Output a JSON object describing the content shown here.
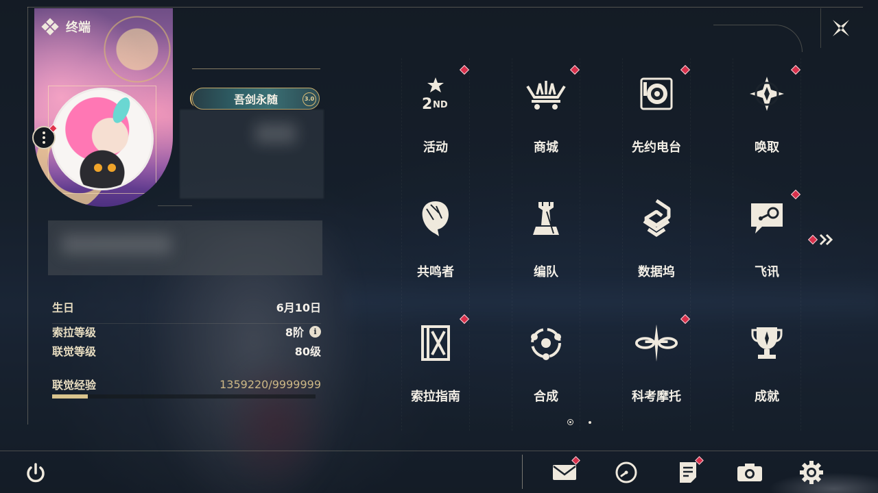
{
  "header": {
    "title": "终端",
    "logo_icon": "diamond-cluster-icon",
    "close_icon": "close-x-icon"
  },
  "profile": {
    "name_badge": "吾剑永随",
    "name_badge_tag": "3.0",
    "menu_icon": "more-vertical-icon",
    "avatar_icon": "avatar-portrait"
  },
  "stats": [
    {
      "label": "生日",
      "value": "6月10日"
    },
    {
      "label": "索拉等级",
      "value": "8阶",
      "info": "i"
    },
    {
      "label": "联觉等级",
      "value": "80级"
    }
  ],
  "experience": {
    "label": "联觉经验",
    "value": "1359220/9999999",
    "progress": 0.1359
  },
  "apps": [
    {
      "label": "活动",
      "icon": "events-icon",
      "badge": true
    },
    {
      "label": "商城",
      "icon": "shop-cart-icon",
      "badge": true
    },
    {
      "label": "先约电台",
      "icon": "radio-record-icon",
      "badge": true
    },
    {
      "label": "唤取",
      "icon": "compass-star-icon",
      "badge": true
    },
    {
      "label": "共鸣者",
      "icon": "character-head-icon",
      "badge": false
    },
    {
      "label": "编队",
      "icon": "chess-team-icon",
      "badge": false
    },
    {
      "label": "数据坞",
      "icon": "data-dock-icon",
      "badge": false
    },
    {
      "label": "飞讯",
      "icon": "chat-message-icon",
      "badge": true
    },
    {
      "label": "索拉指南",
      "icon": "guide-book-icon",
      "badge": true
    },
    {
      "label": "合成",
      "icon": "synthesis-orbit-icon",
      "badge": false
    },
    {
      "label": "科考摩托",
      "icon": "motorbike-icon",
      "badge": true
    },
    {
      "label": "成就",
      "icon": "trophy-icon",
      "badge": false
    }
  ],
  "pager": {
    "pages": 2,
    "current": 1
  },
  "bottom_bar": {
    "power_icon": "power-icon",
    "buttons": [
      {
        "name": "mail",
        "icon": "mail-icon",
        "badge": true
      },
      {
        "name": "history",
        "icon": "clock-icon",
        "badge": false
      },
      {
        "name": "notices",
        "icon": "document-icon",
        "badge": true
      },
      {
        "name": "photo",
        "icon": "camera-icon",
        "badge": false
      },
      {
        "name": "settings",
        "icon": "gear-icon",
        "badge": false
      }
    ]
  },
  "colors": {
    "accent_red": "#d8304b",
    "gold": "#d9c48e",
    "text": "#f3efe6"
  }
}
